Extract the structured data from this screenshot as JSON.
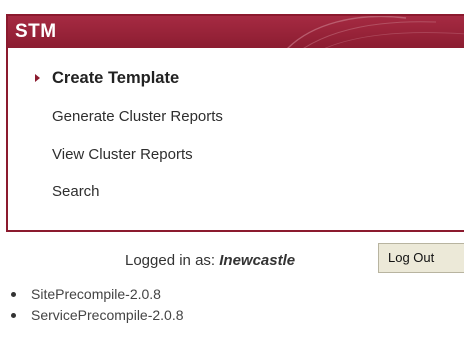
{
  "panel": {
    "title": "STM",
    "accent_color": "#8b1a2e",
    "menu": [
      {
        "label": "Create Template",
        "active": true
      },
      {
        "label": "Generate Cluster Reports",
        "active": false
      },
      {
        "label": "View Cluster Reports",
        "active": false
      },
      {
        "label": "Search",
        "active": false
      }
    ]
  },
  "session": {
    "logged_in_label": "Logged in as:",
    "username": "Inewcastle",
    "logout_label": "Log Out"
  },
  "components": [
    "SitePrecompile-2.0.8",
    "ServicePrecompile-2.0.8"
  ]
}
